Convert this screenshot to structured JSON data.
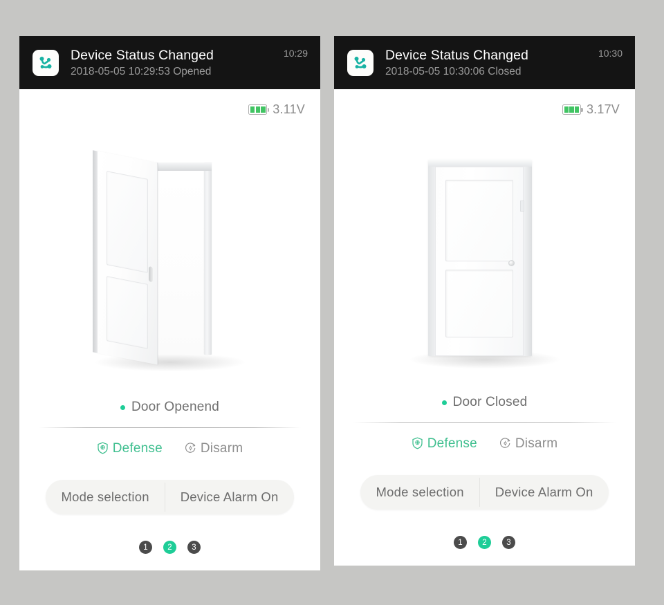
{
  "background_color": "#c6c6c4",
  "accent_color": "#1ecd97",
  "defense_color": "#3fbf8f",
  "disarm_color": "#8e8e8e",
  "panels": [
    {
      "id": "door-opened",
      "notification": {
        "app_icon": "device-network-icon",
        "title": "Device Status Changed",
        "subtitle": "2018-05-05 10:29:53 Opened",
        "time": "10:29"
      },
      "battery": {
        "icon": "battery-full-icon",
        "bars": 3,
        "voltage": "3.11V"
      },
      "illustration": {
        "name": "open-door-illustration",
        "state": "open"
      },
      "status": {
        "dot_color": "#1ecd97",
        "label": "Door Openend"
      },
      "modes": [
        {
          "id": "defense",
          "icon": "shield-icon",
          "label": "Defense",
          "active": true
        },
        {
          "id": "disarm",
          "icon": "disarm-circle-icon",
          "label": "Disarm",
          "active": false
        }
      ],
      "segmented": {
        "left_label": "Mode selection",
        "right_label": "Device Alarm On"
      },
      "pager": {
        "items": [
          "1",
          "2",
          "3"
        ],
        "active_index": 1
      }
    },
    {
      "id": "door-closed",
      "notification": {
        "app_icon": "device-network-icon",
        "title": "Device Status Changed",
        "subtitle": "2018-05-05 10:30:06 Closed",
        "time": "10:30"
      },
      "battery": {
        "icon": "battery-full-icon",
        "bars": 3,
        "voltage": "3.17V"
      },
      "illustration": {
        "name": "closed-door-illustration",
        "state": "closed"
      },
      "status": {
        "dot_color": "#1ecd97",
        "label": "Door Closed"
      },
      "modes": [
        {
          "id": "defense",
          "icon": "shield-icon",
          "label": "Defense",
          "active": true
        },
        {
          "id": "disarm",
          "icon": "disarm-circle-icon",
          "label": "Disarm",
          "active": false
        }
      ],
      "segmented": {
        "left_label": "Mode selection",
        "right_label": "Device Alarm On"
      },
      "pager": {
        "items": [
          "1",
          "2",
          "3"
        ],
        "active_index": 1
      }
    }
  ]
}
